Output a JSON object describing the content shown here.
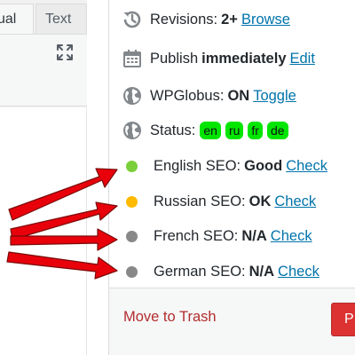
{
  "editor": {
    "tab_visual": "sual",
    "tab_text": "Text"
  },
  "publish_box": {
    "revisions": {
      "label": "Revisions:",
      "value": "2+",
      "link": "Browse"
    },
    "publish": {
      "label": "Publish",
      "value": "immediately",
      "link": "Edit"
    },
    "wpglobus": {
      "label": "WPGlobus:",
      "value": "ON",
      "link": "Toggle"
    },
    "status": {
      "label": "Status:",
      "languages": [
        "en",
        "ru",
        "fr",
        "de"
      ]
    },
    "seo": [
      {
        "label": "English SEO:",
        "value": "Good",
        "link": "Check",
        "color": "#7ad03a"
      },
      {
        "label": "Russian SEO:",
        "value": "OK",
        "link": "Check",
        "color": "#ffba00"
      },
      {
        "label": "French SEO:",
        "value": "N/A",
        "link": "Check",
        "color": "#888888"
      },
      {
        "label": "German SEO:",
        "value": "N/A",
        "link": "Check",
        "color": "#888888"
      }
    ],
    "trash_label": "Move to Trash",
    "publish_button_label": "P"
  },
  "colors": {
    "link": "#0073aa",
    "badge": "#00e600",
    "trash": "#b32d2e",
    "publish_button": "#dc3232",
    "arrow": "#e8000b"
  },
  "icons": [
    "revisions-icon",
    "calendar-icon",
    "globe-icon",
    "globe-icon",
    "expand-icon"
  ]
}
